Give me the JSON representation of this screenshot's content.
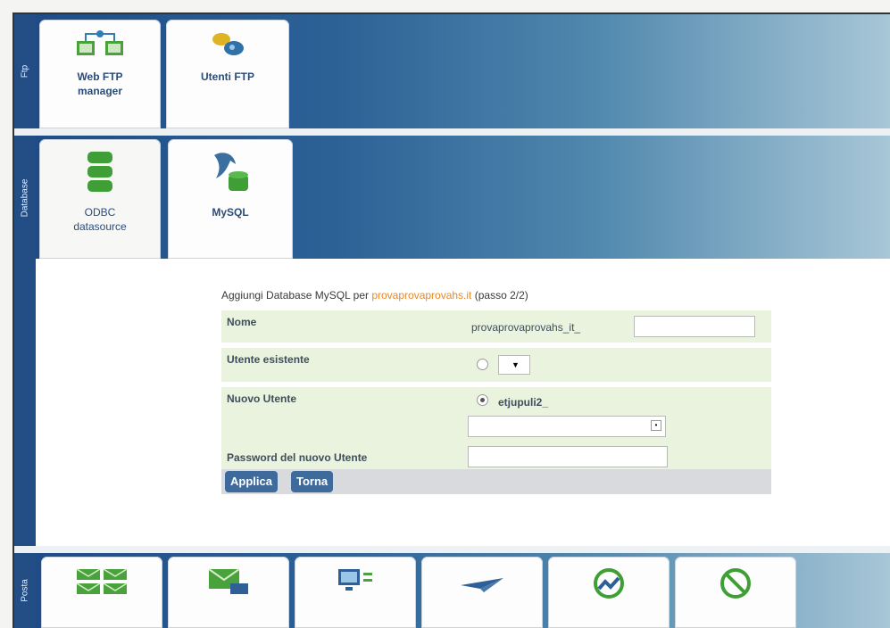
{
  "sections": {
    "ftp": {
      "label": "Ftp",
      "tabs": [
        {
          "label": "Web FTP manager",
          "icon": "web-ftp-icon"
        },
        {
          "label": "Utenti FTP",
          "icon": "ftp-users-icon"
        }
      ]
    },
    "database": {
      "label": "Database",
      "tabs": [
        {
          "label": "ODBC datasource",
          "icon": "database-stack-icon"
        },
        {
          "label": "MySQL",
          "icon": "mysql-dolphin-icon"
        }
      ]
    },
    "posta": {
      "label": "Posta",
      "tabs": [
        {
          "icon": "mail-list-icon"
        },
        {
          "icon": "mail-computer-icon"
        },
        {
          "icon": "monitor-icon"
        },
        {
          "icon": "paper-plane-icon"
        },
        {
          "icon": "antivirus-icon"
        },
        {
          "icon": "block-icon"
        }
      ]
    }
  },
  "form": {
    "title_prefix": "Aggiungi Database MySQL per ",
    "domain": "provaprovaprovahs.it",
    "title_suffix": " (passo 2/2)",
    "nome_label": "Nome",
    "nome_prefix": "provaprovaprovahs_it_",
    "nome_value": "",
    "utente_esistente_label": "Utente esistente",
    "nuovo_utente_label": "Nuovo Utente",
    "nuovo_utente_prefix": "etjupuli2_",
    "nuovo_utente_value": "",
    "password_label": "Password del nuovo Utente",
    "password_value": ""
  },
  "buttons": {
    "applica": "Applica",
    "torna": "Torna"
  },
  "colors": {
    "nav_blue": "#234e85",
    "form_green": "#e9f3dd",
    "domain_orange": "#e9892a"
  }
}
